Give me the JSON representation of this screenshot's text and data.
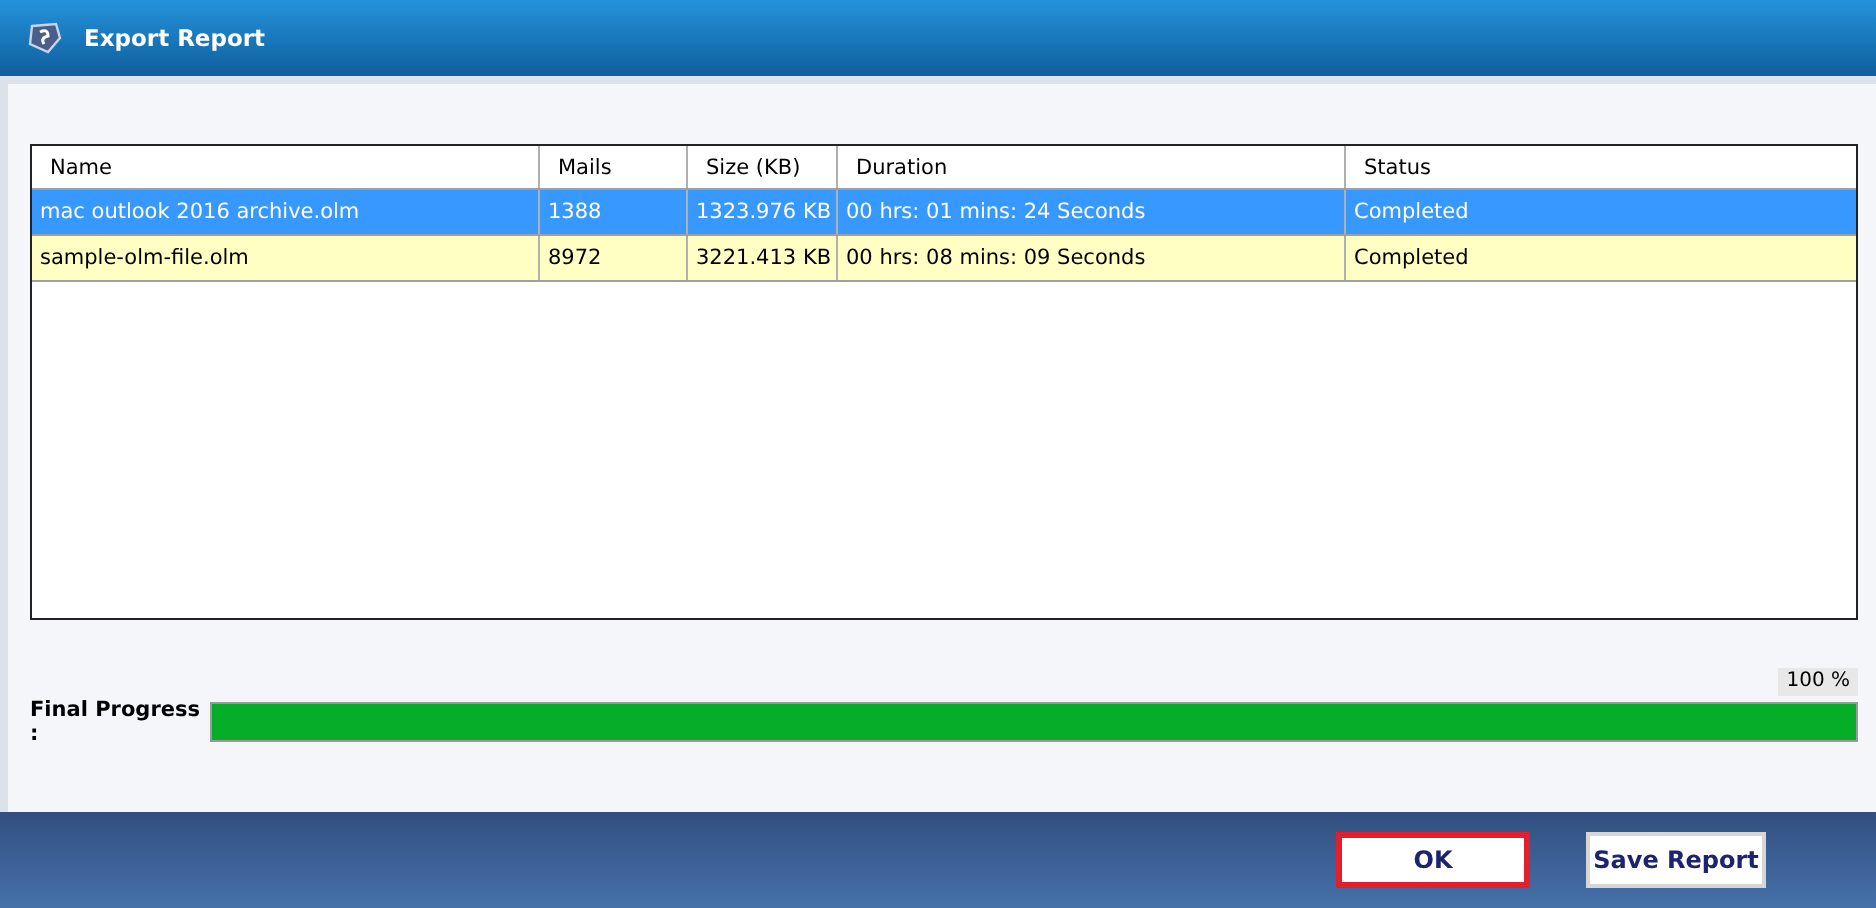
{
  "window": {
    "title": "Export Report"
  },
  "table": {
    "columns": [
      "Name",
      "Mails",
      "Size (KB)",
      "Duration",
      "Status"
    ],
    "rows": [
      {
        "cells": [
          "mac outlook 2016 archive.olm",
          "1388",
          "1323.976 KB",
          "00 hrs: 01 mins: 24 Seconds",
          "Completed"
        ],
        "selected": true
      },
      {
        "cells": [
          "sample-olm-file.olm",
          "8972",
          "3221.413 KB",
          "00 hrs: 08 mins: 09 Seconds",
          "Completed"
        ],
        "selected": false
      }
    ]
  },
  "progress": {
    "label": "Final Progress :",
    "reading": "100 %",
    "level": 1
  },
  "buttons": [
    {
      "label": "OK",
      "focused": true
    },
    {
      "label": "Save Report",
      "focused": false
    }
  ]
}
